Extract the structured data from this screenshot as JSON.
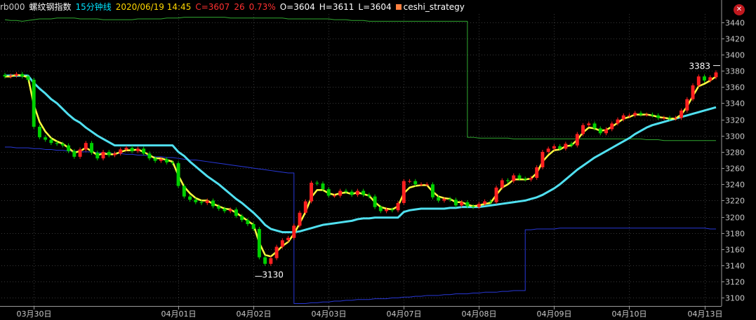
{
  "header": {
    "symbol": "rb000",
    "name": "螺纹钢指数",
    "period": "15分钟线",
    "datetime": "2020/06/19 14:45",
    "close_text": "C=3607",
    "change": "26",
    "change_pct": "0.73%",
    "open_text": "O=3604",
    "high_text": "H=3611",
    "low_text": "L=3604",
    "strategy": "ceshi_strategy",
    "close_icon": "close-circle-icon",
    "colors": {
      "symbol": "#c8c8c8",
      "name": "#ffffff",
      "period": "#00e4ff",
      "datetime": "#ffd700",
      "close": "#ff3030",
      "ohlc": "#ffffff",
      "strategy_swatch": "#ff8040",
      "strategy_text": "#ffffff"
    }
  },
  "chart_data": {
    "type": "candlestick",
    "ylim": [
      3090,
      3450
    ],
    "yticks": [
      3100,
      3120,
      3140,
      3160,
      3180,
      3200,
      3220,
      3240,
      3260,
      3280,
      3300,
      3320,
      3340,
      3360,
      3380,
      3400,
      3420,
      3440
    ],
    "xtick_labels": [
      "03月30日",
      "04月01日",
      "04月02日",
      "04月03日",
      "04月07日",
      "04月08日",
      "04月09日",
      "04月10日",
      "04月13日"
    ],
    "xtick_bar_index": [
      5,
      30,
      43,
      56,
      69,
      82,
      95,
      108,
      121
    ],
    "annotations": [
      {
        "text": "3130",
        "bar_index": 44,
        "value": 3130
      },
      {
        "text": "3383",
        "bar_index": 123,
        "value": 3383
      }
    ],
    "grid": true,
    "colors": {
      "up": "#ff2020",
      "down": "#00d000",
      "grid": "#383838"
    },
    "close": [
      3373,
      3374,
      3376,
      3373,
      3369,
      3311,
      3298,
      3295,
      3291,
      3290,
      3288,
      3281,
      3274,
      3283,
      3291,
      3279,
      3272,
      3280,
      3276,
      3278,
      3283,
      3285,
      3281,
      3284,
      3278,
      3272,
      3269,
      3271,
      3267,
      3266,
      3238,
      3225,
      3221,
      3218,
      3217,
      3220,
      3213,
      3210,
      3207,
      3209,
      3201,
      3196,
      3191,
      3185,
      3150,
      3142,
      3149,
      3163,
      3171,
      3174,
      3189,
      3205,
      3219,
      3242,
      3241,
      3234,
      3226,
      3226,
      3232,
      3231,
      3227,
      3232,
      3227,
      3225,
      3212,
      3207,
      3209,
      3208,
      3217,
      3244,
      3244,
      3240,
      3240,
      3240,
      3224,
      3220,
      3222,
      3221,
      3214,
      3218,
      3213,
      3212,
      3216,
      3219,
      3218,
      3236,
      3245,
      3244,
      3251,
      3247,
      3246,
      3248,
      3261,
      3280,
      3284,
      3287,
      3284,
      3290,
      3288,
      3302,
      3313,
      3315,
      3309,
      3303,
      3308,
      3315,
      3320,
      3325,
      3325,
      3328,
      3326,
      3326,
      3325,
      3322,
      3322,
      3321,
      3322,
      3331,
      3345,
      3362,
      3373,
      3368,
      3372,
      3378
    ],
    "series": [
      {
        "name": "",
        "color": "#ffff40",
        "values": [
          3373,
          3373,
          3375,
          3374,
          3372,
          3338,
          3317,
          3305,
          3297,
          3293,
          3290,
          3285,
          3279,
          3281,
          3285,
          3281,
          3276,
          3278,
          3277,
          3277,
          3280,
          3282,
          3282,
          3283,
          3280,
          3276,
          3272,
          3272,
          3270,
          3268,
          3251,
          3237,
          3229,
          3223,
          3220,
          3220,
          3216,
          3213,
          3210,
          3209,
          3205,
          3200,
          3195,
          3190,
          3168,
          3153,
          3151,
          3157,
          3164,
          3169,
          3179,
          3192,
          3206,
          3224,
          3233,
          3233,
          3229,
          3227,
          3229,
          3230,
          3228,
          3230,
          3228,
          3226,
          3218,
          3212,
          3210,
          3209,
          3213,
          3229,
          3236,
          3238,
          3239,
          3239,
          3231,
          3225,
          3223,
          3222,
          3218,
          3218,
          3215,
          3213,
          3214,
          3216,
          3217,
          3227,
          3236,
          3240,
          3246,
          3246,
          3246,
          3247,
          3254,
          3268,
          3276,
          3282,
          3283,
          3287,
          3288,
          3295,
          3304,
          3310,
          3309,
          3306,
          3307,
          3311,
          3316,
          3321,
          3323,
          3326,
          3326,
          3326,
          3325,
          3323,
          3322,
          3321,
          3321,
          3326,
          3336,
          3349,
          3361,
          3364,
          3368,
          3373
        ]
      },
      {
        "name": "",
        "color": "#50e0f0",
        "values": [
          3374,
          3374,
          3374,
          3374,
          3374,
          3365,
          3358,
          3352,
          3345,
          3340,
          3333,
          3326,
          3320,
          3316,
          3310,
          3305,
          3300,
          3296,
          3292,
          3288,
          3288,
          3288,
          3288,
          3288,
          3288,
          3288,
          3288,
          3288,
          3288,
          3288,
          3280,
          3275,
          3268,
          3262,
          3256,
          3250,
          3245,
          3240,
          3234,
          3228,
          3222,
          3217,
          3211,
          3205,
          3198,
          3190,
          3185,
          3183,
          3181,
          3181,
          3181,
          3182,
          3184,
          3186,
          3188,
          3190,
          3191,
          3192,
          3193,
          3194,
          3195,
          3197,
          3198,
          3198,
          3199,
          3199,
          3199,
          3199,
          3199,
          3206,
          3208,
          3209,
          3210,
          3210,
          3210,
          3210,
          3210,
          3211,
          3211,
          3212,
          3212,
          3212,
          3212,
          3213,
          3214,
          3215,
          3216,
          3217,
          3218,
          3219,
          3220,
          3222,
          3224,
          3227,
          3231,
          3235,
          3240,
          3246,
          3252,
          3258,
          3263,
          3268,
          3273,
          3277,
          3281,
          3285,
          3289,
          3293,
          3297,
          3302,
          3306,
          3310,
          3313,
          3315,
          3317,
          3319,
          3321,
          3323,
          3325,
          3327,
          3329,
          3331,
          3333,
          3335
        ]
      },
      {
        "name": "",
        "color": "#2838d8",
        "values": [
          3286,
          3286,
          3285,
          3285,
          3285,
          3284,
          3284,
          3283,
          3283,
          3282,
          3282,
          3281,
          3281,
          3280,
          3280,
          3280,
          3279,
          3279,
          3278,
          3278,
          3278,
          3277,
          3277,
          3276,
          3276,
          3275,
          3274,
          3274,
          3273,
          3273,
          3272,
          3271,
          3270,
          3270,
          3269,
          3268,
          3267,
          3266,
          3265,
          3264,
          3263,
          3262,
          3261,
          3260,
          3259,
          3258,
          3257,
          3256,
          3255,
          3254,
          3093,
          3093,
          3093,
          3094,
          3094,
          3095,
          3095,
          3096,
          3096,
          3097,
          3097,
          3098,
          3098,
          3098,
          3099,
          3099,
          3099,
          3100,
          3100,
          3101,
          3101,
          3102,
          3102,
          3103,
          3103,
          3103,
          3104,
          3104,
          3105,
          3105,
          3105,
          3106,
          3106,
          3107,
          3107,
          3107,
          3108,
          3108,
          3109,
          3109,
          3184,
          3184,
          3185,
          3185,
          3185,
          3185,
          3186,
          3186,
          3186,
          3186,
          3186,
          3186,
          3186,
          3186,
          3186,
          3186,
          3186,
          3186,
          3186,
          3186,
          3186,
          3186,
          3186,
          3186,
          3186,
          3186,
          3186,
          3186,
          3186,
          3186,
          3186,
          3186,
          3185,
          3185
        ]
      },
      {
        "name": "",
        "color": "#30a830",
        "values": [
          3443,
          3442,
          3442,
          3441,
          3442,
          3443,
          3444,
          3444,
          3444,
          3445,
          3445,
          3445,
          3445,
          3444,
          3444,
          3444,
          3444,
          3443,
          3443,
          3443,
          3443,
          3443,
          3443,
          3444,
          3444,
          3444,
          3444,
          3444,
          3445,
          3445,
          3445,
          3446,
          3446,
          3446,
          3446,
          3446,
          3446,
          3446,
          3446,
          3445,
          3445,
          3445,
          3445,
          3445,
          3445,
          3445,
          3445,
          3445,
          3445,
          3444,
          3444,
          3444,
          3444,
          3444,
          3444,
          3444,
          3444,
          3443,
          3443,
          3443,
          3442,
          3442,
          3442,
          3441,
          3441,
          3441,
          3441,
          3441,
          3441,
          3441,
          3441,
          3441,
          3441,
          3441,
          3441,
          3441,
          3441,
          3441,
          3441,
          3441,
          3298,
          3298,
          3297,
          3297,
          3297,
          3297,
          3297,
          3297,
          3296,
          3296,
          3296,
          3296,
          3296,
          3296,
          3296,
          3296,
          3296,
          3296,
          3296,
          3296,
          3296,
          3296,
          3296,
          3296,
          3296,
          3296,
          3296,
          3296,
          3296,
          3296,
          3296,
          3295,
          3295,
          3295,
          3294,
          3294,
          3294,
          3294,
          3294,
          3294,
          3294,
          3294,
          3294,
          3294
        ]
      }
    ]
  }
}
